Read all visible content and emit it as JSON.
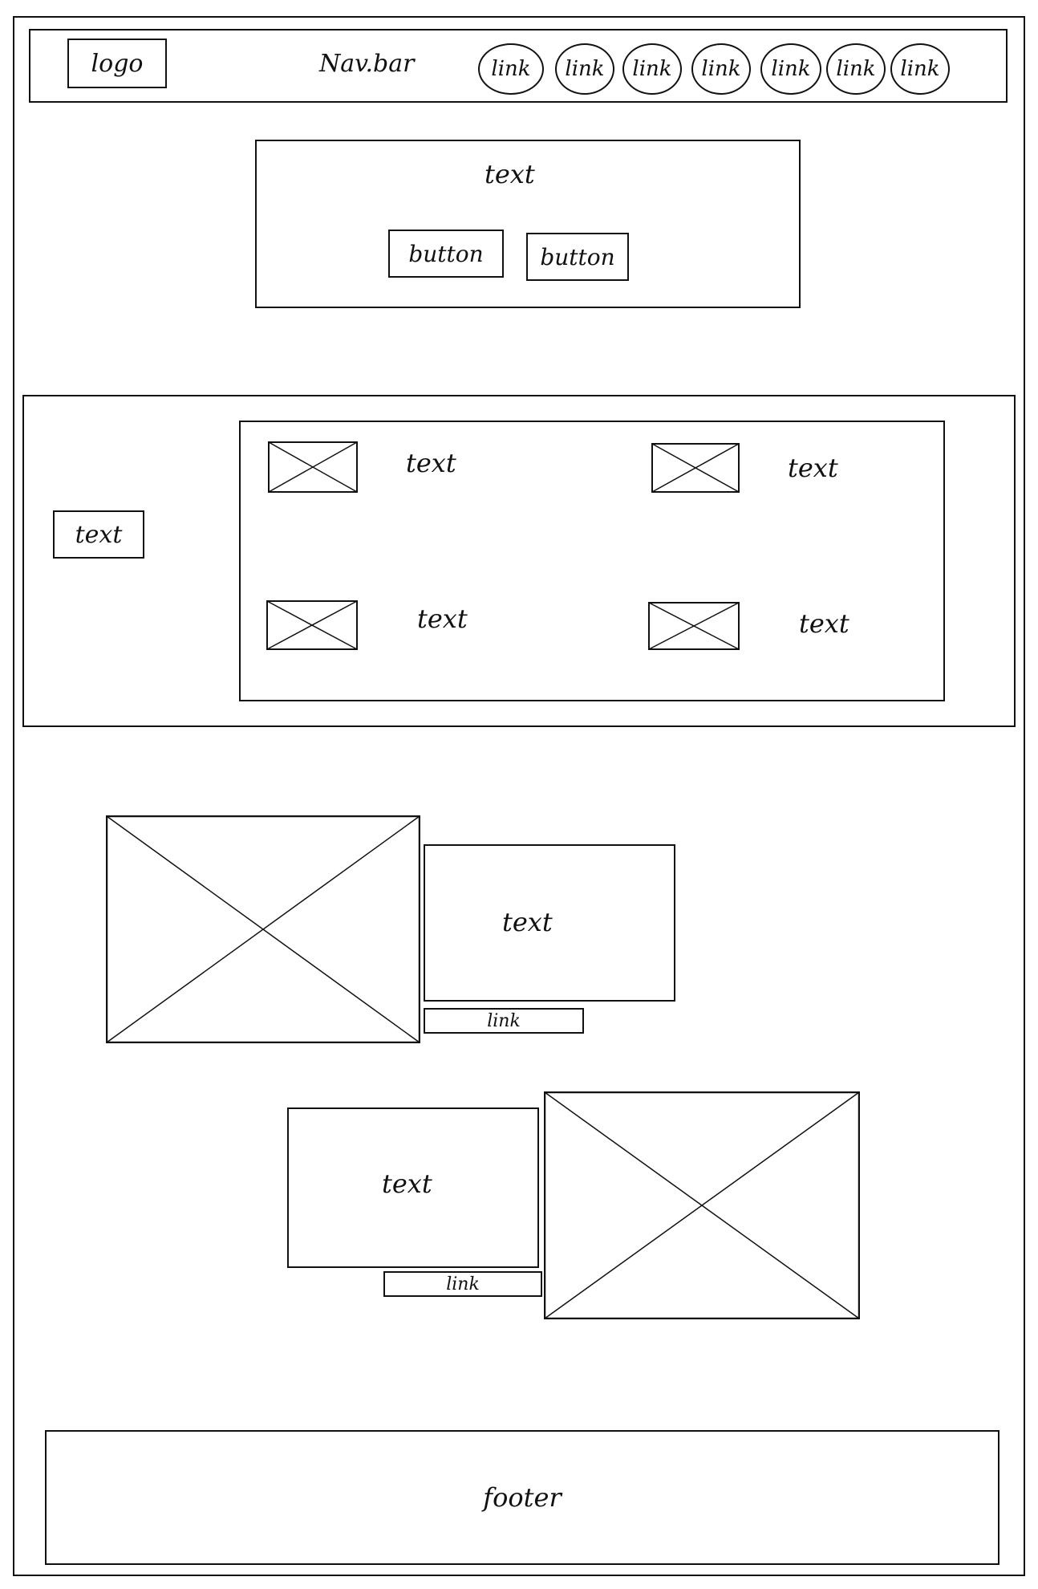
{
  "navbar": {
    "logo": "logo",
    "title": "Nav.bar",
    "links": [
      "link",
      "link",
      "link",
      "link",
      "link",
      "link",
      "link"
    ]
  },
  "hero": {
    "text": "text",
    "buttons": [
      "button",
      "button"
    ]
  },
  "features": {
    "side_text": "text",
    "items": [
      "text",
      "text",
      "text",
      "text"
    ]
  },
  "content_rows": [
    {
      "text": "text",
      "link": "link"
    },
    {
      "text": "text",
      "link": "link"
    }
  ],
  "footer": {
    "text": "footer"
  }
}
